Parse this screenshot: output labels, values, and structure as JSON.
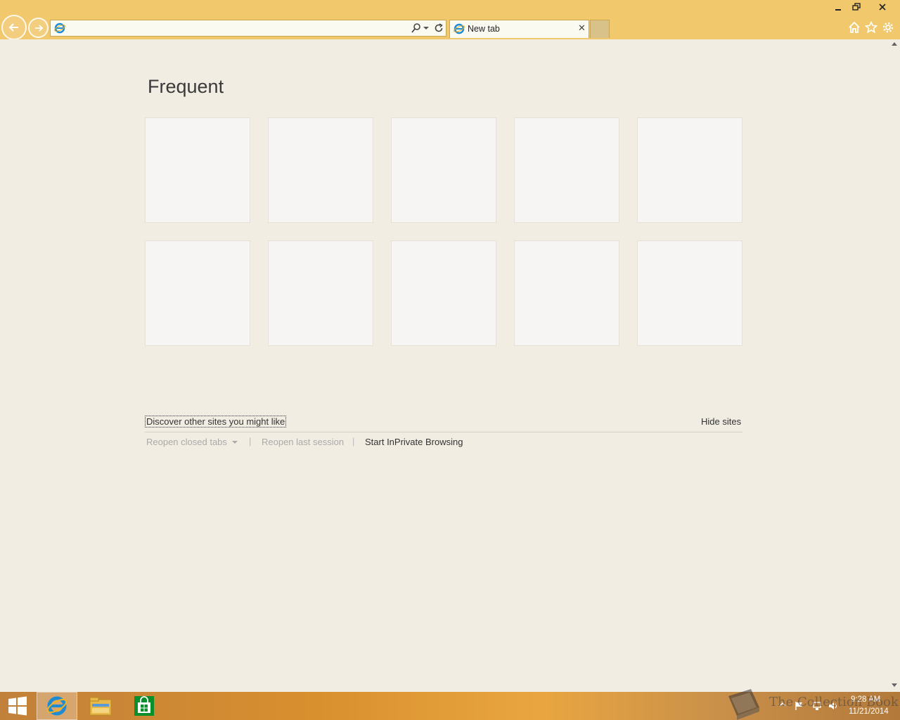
{
  "browser": {
    "address": {
      "value": "",
      "placeholder": ""
    },
    "tab": {
      "label": "New tab",
      "close_glyph": "✕"
    },
    "window_controls": {
      "minimize": "–",
      "maximize": "❐",
      "close": "✕"
    }
  },
  "new_tab_page": {
    "section_title": "Frequent",
    "tiles": [
      {},
      {},
      {},
      {},
      {},
      {},
      {},
      {},
      {},
      {}
    ],
    "discover_link": "Discover other sites you might like",
    "hide_sites": "Hide sites",
    "reopen_closed_tabs": "Reopen closed tabs",
    "reopen_last_session": "Reopen last session",
    "inprivate": "Start InPrivate Browsing",
    "separator": "|"
  },
  "taskbar": {
    "apps": [
      "start-icon",
      "internet-explorer-icon",
      "file-explorer-icon",
      "store-icon"
    ],
    "clock": {
      "time": "9:28 AM",
      "date": "11/21/2014"
    }
  },
  "watermark": {
    "text": "The Collection Book"
  },
  "colors": {
    "chrome": "#f2c86d",
    "page_bg": "#f2ede3",
    "tile_bg": "#f6f5f3",
    "close_red": "#e81123"
  }
}
